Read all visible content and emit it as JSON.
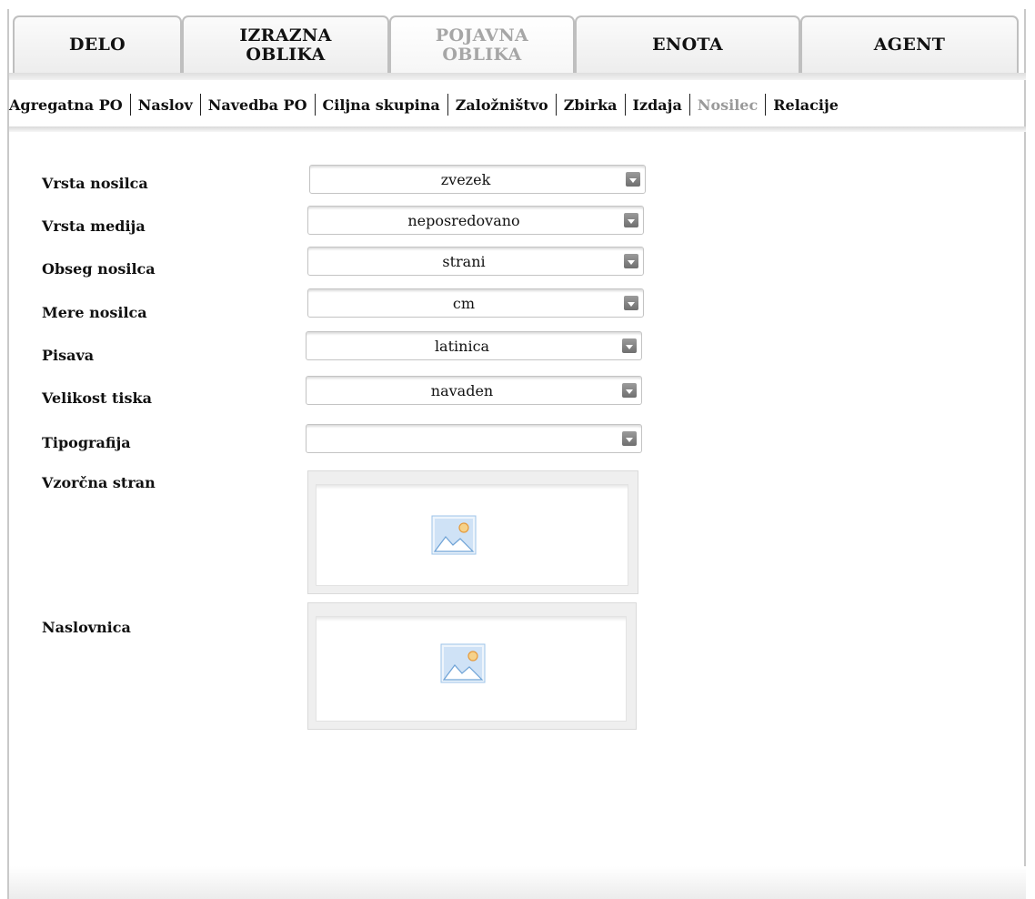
{
  "tabs": [
    {
      "label": "DELO"
    },
    {
      "label": "IZRAZNA\nOBLIKA"
    },
    {
      "label": "POJAVNA\nOBLIKA"
    },
    {
      "label": "ENOTA"
    },
    {
      "label": "AGENT"
    }
  ],
  "active_tab": "POJAVNA OBLIKA",
  "subnav": [
    {
      "label": "Agregatna PO"
    },
    {
      "label": "Naslov"
    },
    {
      "label": "Navedba PO"
    },
    {
      "label": "Ciljna skupina"
    },
    {
      "label": "Založništvo"
    },
    {
      "label": "Zbirka"
    },
    {
      "label": "Izdaja"
    },
    {
      "label": "Nosilec"
    },
    {
      "label": "Relacije"
    }
  ],
  "active_subnav": "Nosilec",
  "form": {
    "fields": [
      {
        "label": "Vrsta nosilca",
        "value": "zvezek"
      },
      {
        "label": "Vrsta medija",
        "value": "neposredovano"
      },
      {
        "label": "Obseg nosilca",
        "value": "strani"
      },
      {
        "label": "Mere nosilca",
        "value": "cm"
      },
      {
        "label": "Pisava",
        "value": "latinica"
      },
      {
        "label": "Velikost tiska",
        "value": "navaden"
      },
      {
        "label": "Tipografija",
        "value": ""
      }
    ],
    "images": [
      {
        "label": "Vzorčna stran"
      },
      {
        "label": "Naslovnica"
      }
    ]
  },
  "colors": {
    "active_text": "#a6a6a6",
    "text": "#111111",
    "dropdown_arrow": "#808080",
    "image_sky": "#bcd6f0"
  },
  "icons": [
    "dropdown-arrow-icon",
    "image-placeholder-icon"
  ]
}
